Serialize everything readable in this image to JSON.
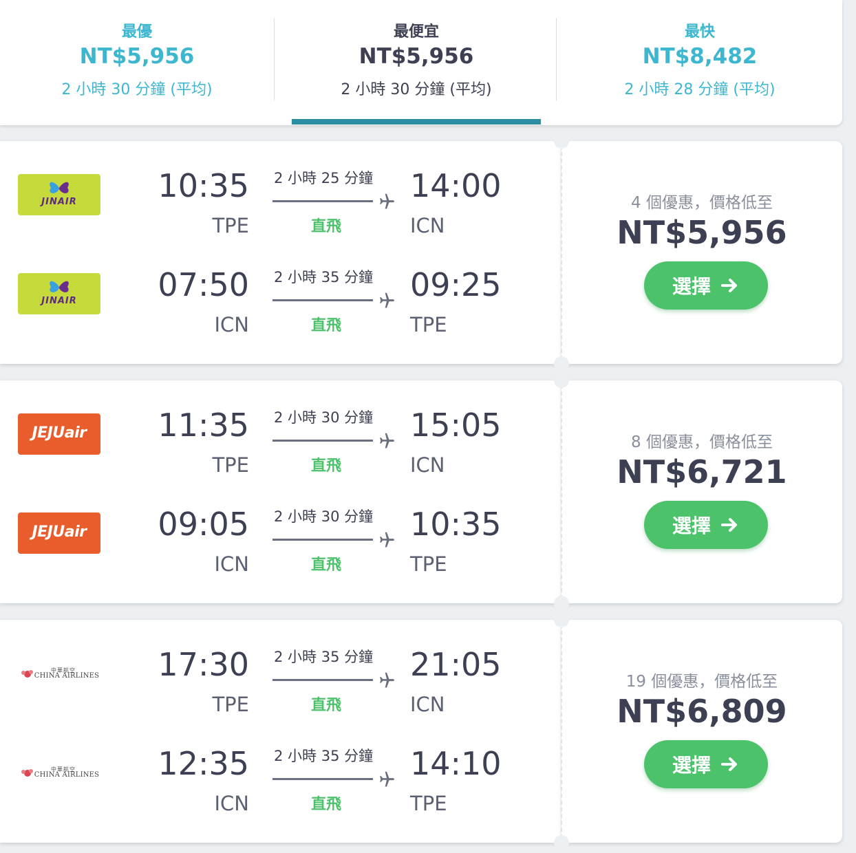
{
  "sort_tabs": [
    {
      "label": "最優",
      "price": "NT$5,956",
      "duration": "2 小時 30 分鐘 (平均)"
    },
    {
      "label": "最便宜",
      "price": "NT$5,956",
      "duration": "2 小時 30 分鐘 (平均)"
    },
    {
      "label": "最快",
      "price": "NT$8,482",
      "duration": "2 小時 28 分鐘 (平均)"
    }
  ],
  "active_tab": "最便宜",
  "colors": {
    "teal": "#3db7cf",
    "active_underline": "#2c8ea5",
    "green": "#4cc26a",
    "text_dark": "#3d4052"
  },
  "results": [
    {
      "airline": "Jin Air",
      "logo_text": "JINAIR",
      "offers": "4 個優惠，價格低至",
      "price": "NT$5,956",
      "select_label": "選擇",
      "legs": [
        {
          "dep_time": "10:35",
          "dep_airport": "TPE",
          "duration": "2 小時 25 分鐘",
          "stops": "直飛",
          "arr_time": "14:00",
          "arr_airport": "ICN"
        },
        {
          "dep_time": "07:50",
          "dep_airport": "ICN",
          "duration": "2 小時 35 分鐘",
          "stops": "直飛",
          "arr_time": "09:25",
          "arr_airport": "TPE"
        }
      ]
    },
    {
      "airline": "Jeju Air",
      "logo_text": "JEJUair",
      "offers": "8 個優惠，價格低至",
      "price": "NT$6,721",
      "select_label": "選擇",
      "legs": [
        {
          "dep_time": "11:35",
          "dep_airport": "TPE",
          "duration": "2 小時 30 分鐘",
          "stops": "直飛",
          "arr_time": "15:05",
          "arr_airport": "ICN"
        },
        {
          "dep_time": "09:05",
          "dep_airport": "ICN",
          "duration": "2 小時 30 分鐘",
          "stops": "直飛",
          "arr_time": "10:35",
          "arr_airport": "TPE"
        }
      ]
    },
    {
      "airline": "China Airlines",
      "logo_text": "CHINA AIRLINES",
      "logo_han": "中華航空",
      "offers": "19 個優惠，價格低至",
      "price": "NT$6,809",
      "select_label": "選擇",
      "legs": [
        {
          "dep_time": "17:30",
          "dep_airport": "TPE",
          "duration": "2 小時 35 分鐘",
          "stops": "直飛",
          "arr_time": "21:05",
          "arr_airport": "ICN"
        },
        {
          "dep_time": "12:35",
          "dep_airport": "ICN",
          "duration": "2 小時 35 分鐘",
          "stops": "直飛",
          "arr_time": "14:10",
          "arr_airport": "TPE"
        }
      ]
    }
  ]
}
